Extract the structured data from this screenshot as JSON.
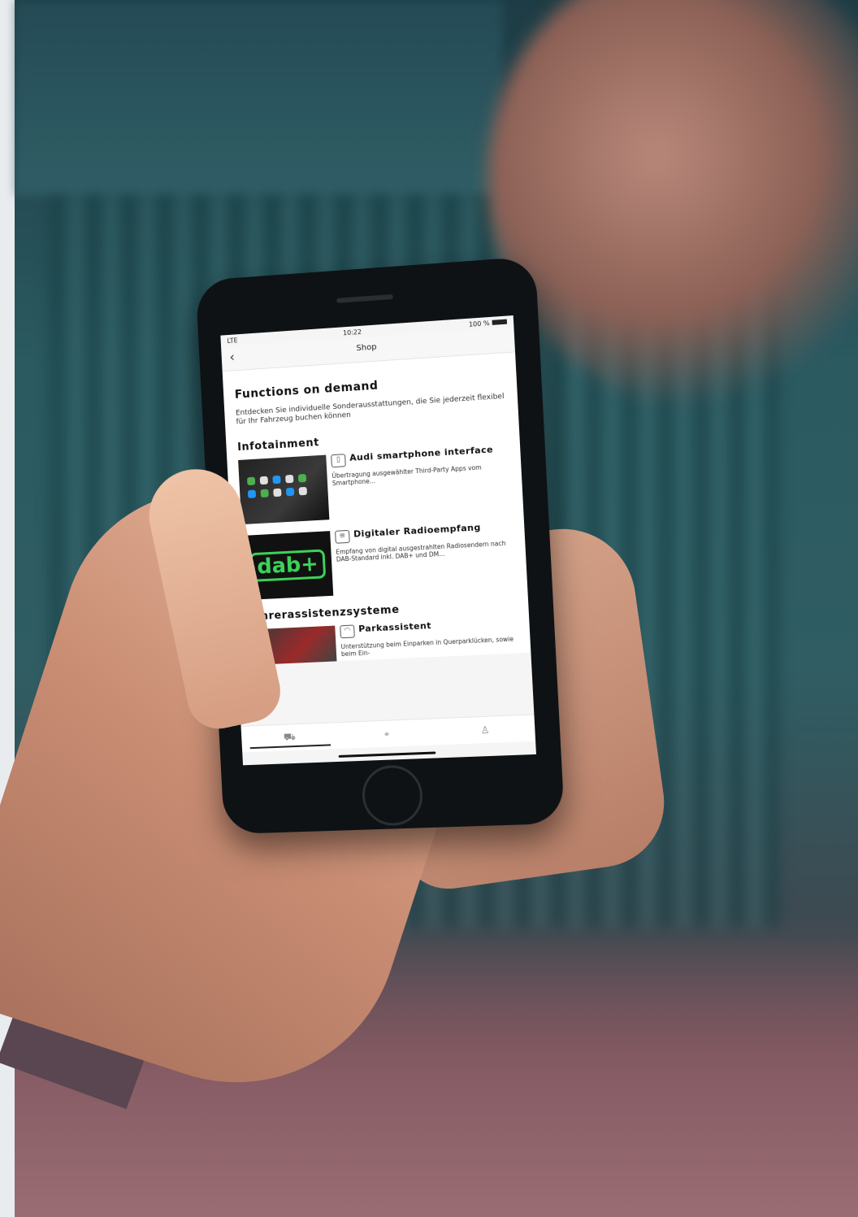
{
  "status_bar": {
    "carrier": "LTE",
    "time": "10:22",
    "battery": "100 %"
  },
  "nav": {
    "back_icon": "chevron-left-icon",
    "title": "Shop"
  },
  "page": {
    "heading": "Functions on demand",
    "intro": "Entdecken Sie individuelle Sonderausstattungen, die Sie jederzeit flexibel für Ihr Fahrzeug buchen können"
  },
  "sections": [
    {
      "title": "Infotainment",
      "items": [
        {
          "name": "Audi smartphone interface",
          "description": "Übertragung ausgewählter Third-Party Apps vom Smartphone..."
        },
        {
          "name": "Digitaler Radioempfang",
          "description": "Empfang von digital ausgestrahlten Radiosendern nach DAB-Standard inkl. DAB+ und DM..."
        }
      ]
    },
    {
      "title": "Fahrerassistenzsysteme",
      "items": [
        {
          "name": "Parkassistent",
          "description": "Unterstützung beim Einparken in Querparklücken, sowie beim Ein-"
        }
      ]
    }
  ],
  "dab_logo": "dab+",
  "tab_bar": [
    {
      "icon": "car-icon",
      "active": true
    },
    {
      "icon": "location-pin-icon",
      "active": false
    },
    {
      "icon": "user-icon",
      "active": false
    }
  ],
  "colors": {
    "dab_green": "#3bd35a",
    "screen_bg": "#f5f5f5"
  }
}
